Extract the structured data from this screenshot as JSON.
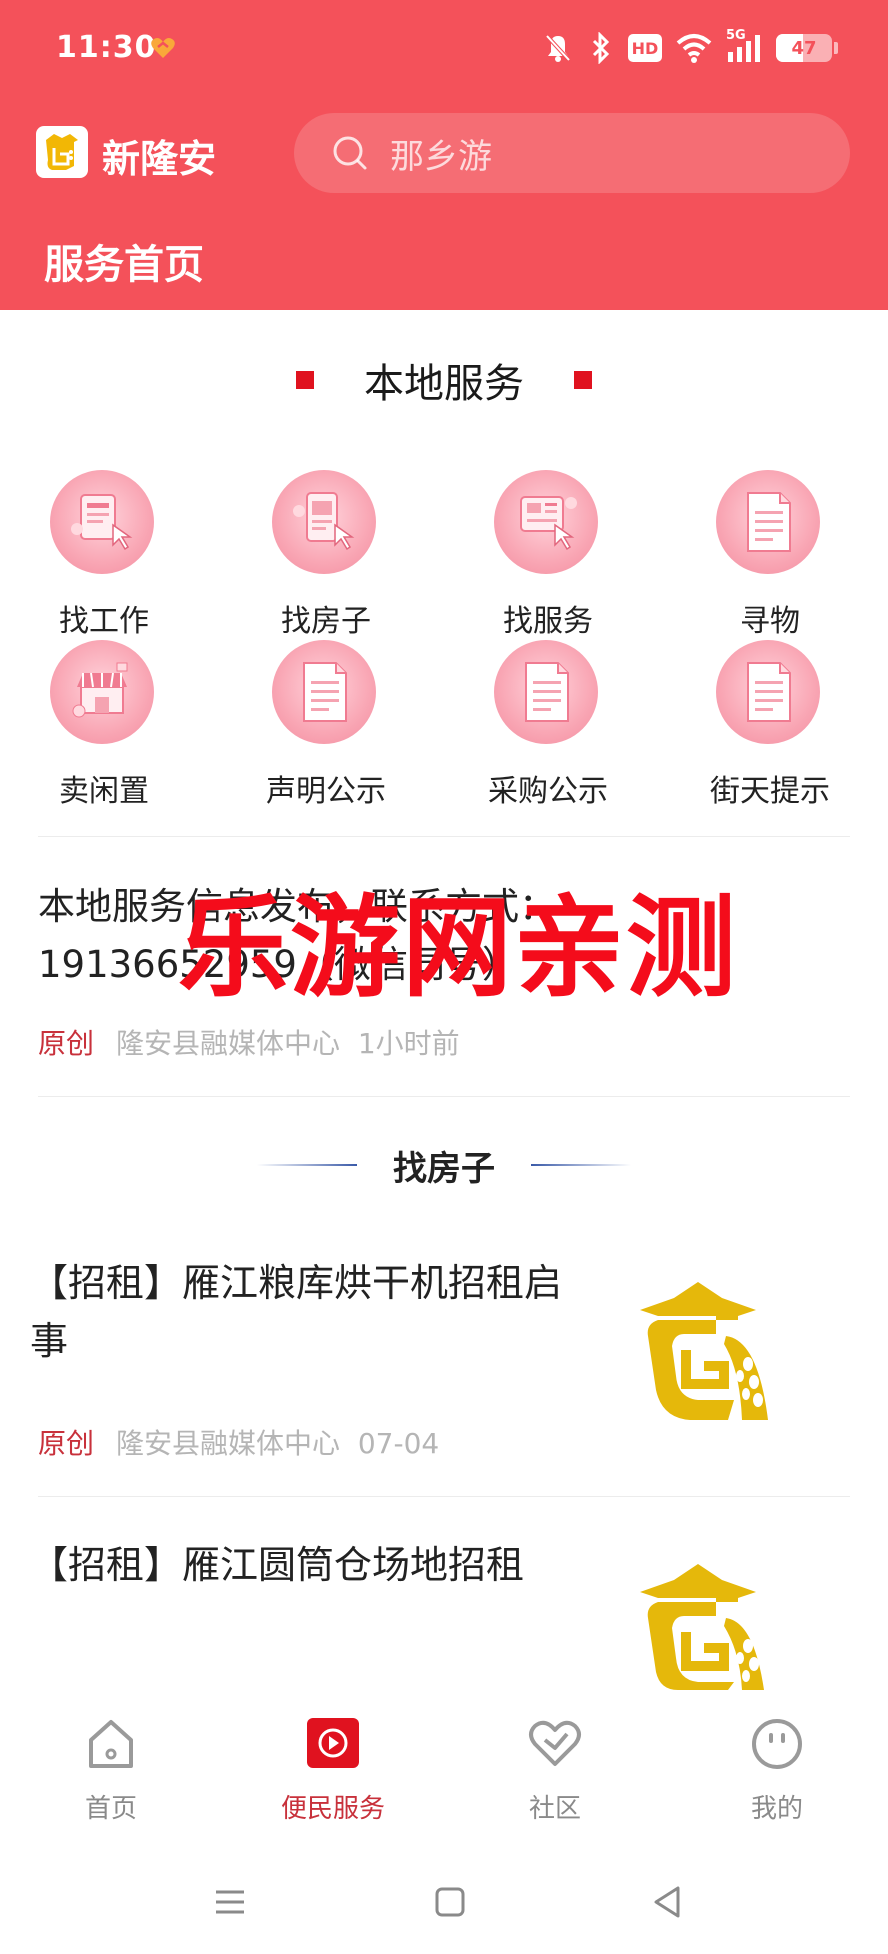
{
  "status_bar": {
    "time": "11:30",
    "hd_label": "HD",
    "net_label": "5G",
    "battery": "47"
  },
  "header": {
    "app_name": "新隆安",
    "search_placeholder": "那乡游",
    "page_title": "服务首页"
  },
  "local_services": {
    "title": "本地服务",
    "items": [
      {
        "label": "找工作",
        "icon": "job-icon"
      },
      {
        "label": "找房子",
        "icon": "house-icon"
      },
      {
        "label": "找服务",
        "icon": "service-icon"
      },
      {
        "label": "寻物",
        "icon": "document-icon"
      },
      {
        "label": "卖闲置",
        "icon": "shop-icon"
      },
      {
        "label": "声明公示",
        "icon": "document-icon"
      },
      {
        "label": "采购公示",
        "icon": "document-icon"
      },
      {
        "label": "街天提示",
        "icon": "document-icon"
      }
    ]
  },
  "notice": {
    "text": "本地服务信息发布，联系方式：19136652959（微信同号）",
    "tag": "原创",
    "source": "隆安县融媒体中心",
    "time": "1小时前"
  },
  "watermark": "乐游网亲测",
  "house_section": {
    "title": "找房子",
    "articles": [
      {
        "title": "【招租】雁江粮库烘干机招租启事",
        "tag": "原创",
        "source": "隆安县融媒体中心",
        "time": "07-04"
      },
      {
        "title": "【招租】雁江圆筒仓场地招租"
      }
    ]
  },
  "bottom_nav": [
    {
      "label": "首页",
      "icon": "home-icon",
      "active": false
    },
    {
      "label": "便民服务",
      "icon": "play-icon",
      "active": true
    },
    {
      "label": "社区",
      "icon": "heart-icon",
      "active": false
    },
    {
      "label": "我的",
      "icon": "smile-icon",
      "active": false
    }
  ],
  "colors": {
    "header": "#f4515a",
    "accent": "#c8313b",
    "watermark": "#f40c1b"
  }
}
